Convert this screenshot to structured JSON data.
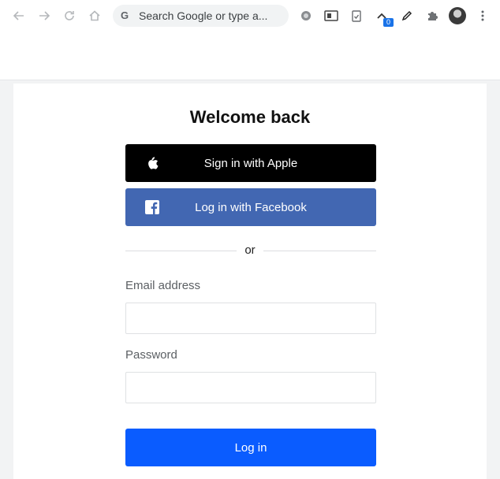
{
  "browser": {
    "omnibox_placeholder": "Search Google or type a...",
    "omnibox_logo": "G",
    "extension_badge": "0",
    "icons": [
      "back-icon",
      "forward-icon",
      "reload-icon",
      "home-icon",
      "extension-icon",
      "translate-icon",
      "clipboard-icon",
      "chevron-icon",
      "pen-icon",
      "puzzle-icon",
      "avatar",
      "more-icon"
    ]
  },
  "login": {
    "title": "Welcome back",
    "apple_label": "Sign in with Apple",
    "facebook_label": "Log in with Facebook",
    "or_text": "or",
    "email_label": "Email address",
    "email_value": "",
    "password_label": "Password",
    "password_value": "",
    "submit_label": "Log in"
  },
  "colors": {
    "apple": "#000000",
    "facebook": "#4267b2",
    "primary": "#0a5cff"
  }
}
